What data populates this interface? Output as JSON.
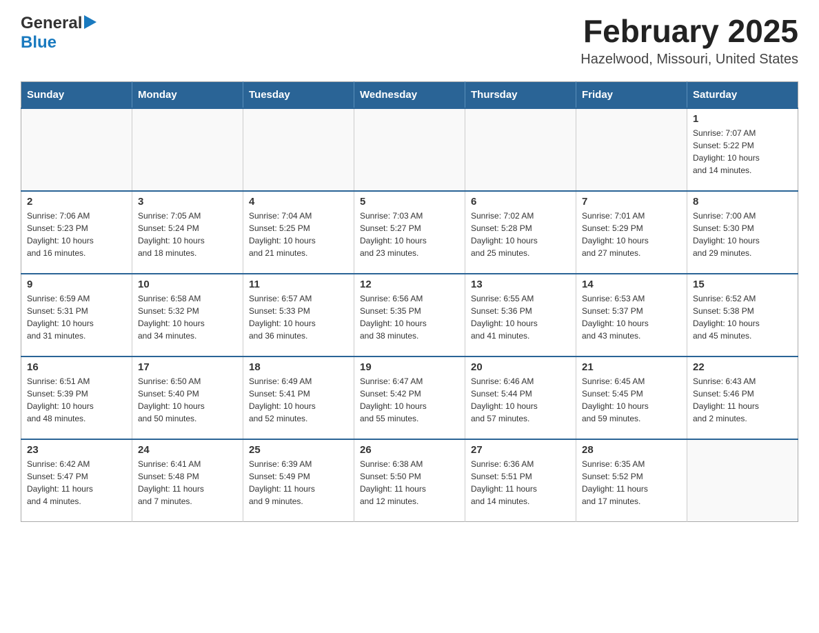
{
  "header": {
    "logo_general": "General",
    "logo_blue": "Blue",
    "title": "February 2025",
    "subtitle": "Hazelwood, Missouri, United States"
  },
  "weekdays": [
    "Sunday",
    "Monday",
    "Tuesday",
    "Wednesday",
    "Thursday",
    "Friday",
    "Saturday"
  ],
  "weeks": [
    {
      "days": [
        {
          "num": "",
          "info": ""
        },
        {
          "num": "",
          "info": ""
        },
        {
          "num": "",
          "info": ""
        },
        {
          "num": "",
          "info": ""
        },
        {
          "num": "",
          "info": ""
        },
        {
          "num": "",
          "info": ""
        },
        {
          "num": "1",
          "info": "Sunrise: 7:07 AM\nSunset: 5:22 PM\nDaylight: 10 hours\nand 14 minutes."
        }
      ]
    },
    {
      "days": [
        {
          "num": "2",
          "info": "Sunrise: 7:06 AM\nSunset: 5:23 PM\nDaylight: 10 hours\nand 16 minutes."
        },
        {
          "num": "3",
          "info": "Sunrise: 7:05 AM\nSunset: 5:24 PM\nDaylight: 10 hours\nand 18 minutes."
        },
        {
          "num": "4",
          "info": "Sunrise: 7:04 AM\nSunset: 5:25 PM\nDaylight: 10 hours\nand 21 minutes."
        },
        {
          "num": "5",
          "info": "Sunrise: 7:03 AM\nSunset: 5:27 PM\nDaylight: 10 hours\nand 23 minutes."
        },
        {
          "num": "6",
          "info": "Sunrise: 7:02 AM\nSunset: 5:28 PM\nDaylight: 10 hours\nand 25 minutes."
        },
        {
          "num": "7",
          "info": "Sunrise: 7:01 AM\nSunset: 5:29 PM\nDaylight: 10 hours\nand 27 minutes."
        },
        {
          "num": "8",
          "info": "Sunrise: 7:00 AM\nSunset: 5:30 PM\nDaylight: 10 hours\nand 29 minutes."
        }
      ]
    },
    {
      "days": [
        {
          "num": "9",
          "info": "Sunrise: 6:59 AM\nSunset: 5:31 PM\nDaylight: 10 hours\nand 31 minutes."
        },
        {
          "num": "10",
          "info": "Sunrise: 6:58 AM\nSunset: 5:32 PM\nDaylight: 10 hours\nand 34 minutes."
        },
        {
          "num": "11",
          "info": "Sunrise: 6:57 AM\nSunset: 5:33 PM\nDaylight: 10 hours\nand 36 minutes."
        },
        {
          "num": "12",
          "info": "Sunrise: 6:56 AM\nSunset: 5:35 PM\nDaylight: 10 hours\nand 38 minutes."
        },
        {
          "num": "13",
          "info": "Sunrise: 6:55 AM\nSunset: 5:36 PM\nDaylight: 10 hours\nand 41 minutes."
        },
        {
          "num": "14",
          "info": "Sunrise: 6:53 AM\nSunset: 5:37 PM\nDaylight: 10 hours\nand 43 minutes."
        },
        {
          "num": "15",
          "info": "Sunrise: 6:52 AM\nSunset: 5:38 PM\nDaylight: 10 hours\nand 45 minutes."
        }
      ]
    },
    {
      "days": [
        {
          "num": "16",
          "info": "Sunrise: 6:51 AM\nSunset: 5:39 PM\nDaylight: 10 hours\nand 48 minutes."
        },
        {
          "num": "17",
          "info": "Sunrise: 6:50 AM\nSunset: 5:40 PM\nDaylight: 10 hours\nand 50 minutes."
        },
        {
          "num": "18",
          "info": "Sunrise: 6:49 AM\nSunset: 5:41 PM\nDaylight: 10 hours\nand 52 minutes."
        },
        {
          "num": "19",
          "info": "Sunrise: 6:47 AM\nSunset: 5:42 PM\nDaylight: 10 hours\nand 55 minutes."
        },
        {
          "num": "20",
          "info": "Sunrise: 6:46 AM\nSunset: 5:44 PM\nDaylight: 10 hours\nand 57 minutes."
        },
        {
          "num": "21",
          "info": "Sunrise: 6:45 AM\nSunset: 5:45 PM\nDaylight: 10 hours\nand 59 minutes."
        },
        {
          "num": "22",
          "info": "Sunrise: 6:43 AM\nSunset: 5:46 PM\nDaylight: 11 hours\nand 2 minutes."
        }
      ]
    },
    {
      "days": [
        {
          "num": "23",
          "info": "Sunrise: 6:42 AM\nSunset: 5:47 PM\nDaylight: 11 hours\nand 4 minutes."
        },
        {
          "num": "24",
          "info": "Sunrise: 6:41 AM\nSunset: 5:48 PM\nDaylight: 11 hours\nand 7 minutes."
        },
        {
          "num": "25",
          "info": "Sunrise: 6:39 AM\nSunset: 5:49 PM\nDaylight: 11 hours\nand 9 minutes."
        },
        {
          "num": "26",
          "info": "Sunrise: 6:38 AM\nSunset: 5:50 PM\nDaylight: 11 hours\nand 12 minutes."
        },
        {
          "num": "27",
          "info": "Sunrise: 6:36 AM\nSunset: 5:51 PM\nDaylight: 11 hours\nand 14 minutes."
        },
        {
          "num": "28",
          "info": "Sunrise: 6:35 AM\nSunset: 5:52 PM\nDaylight: 11 hours\nand 17 minutes."
        },
        {
          "num": "",
          "info": ""
        }
      ]
    }
  ]
}
